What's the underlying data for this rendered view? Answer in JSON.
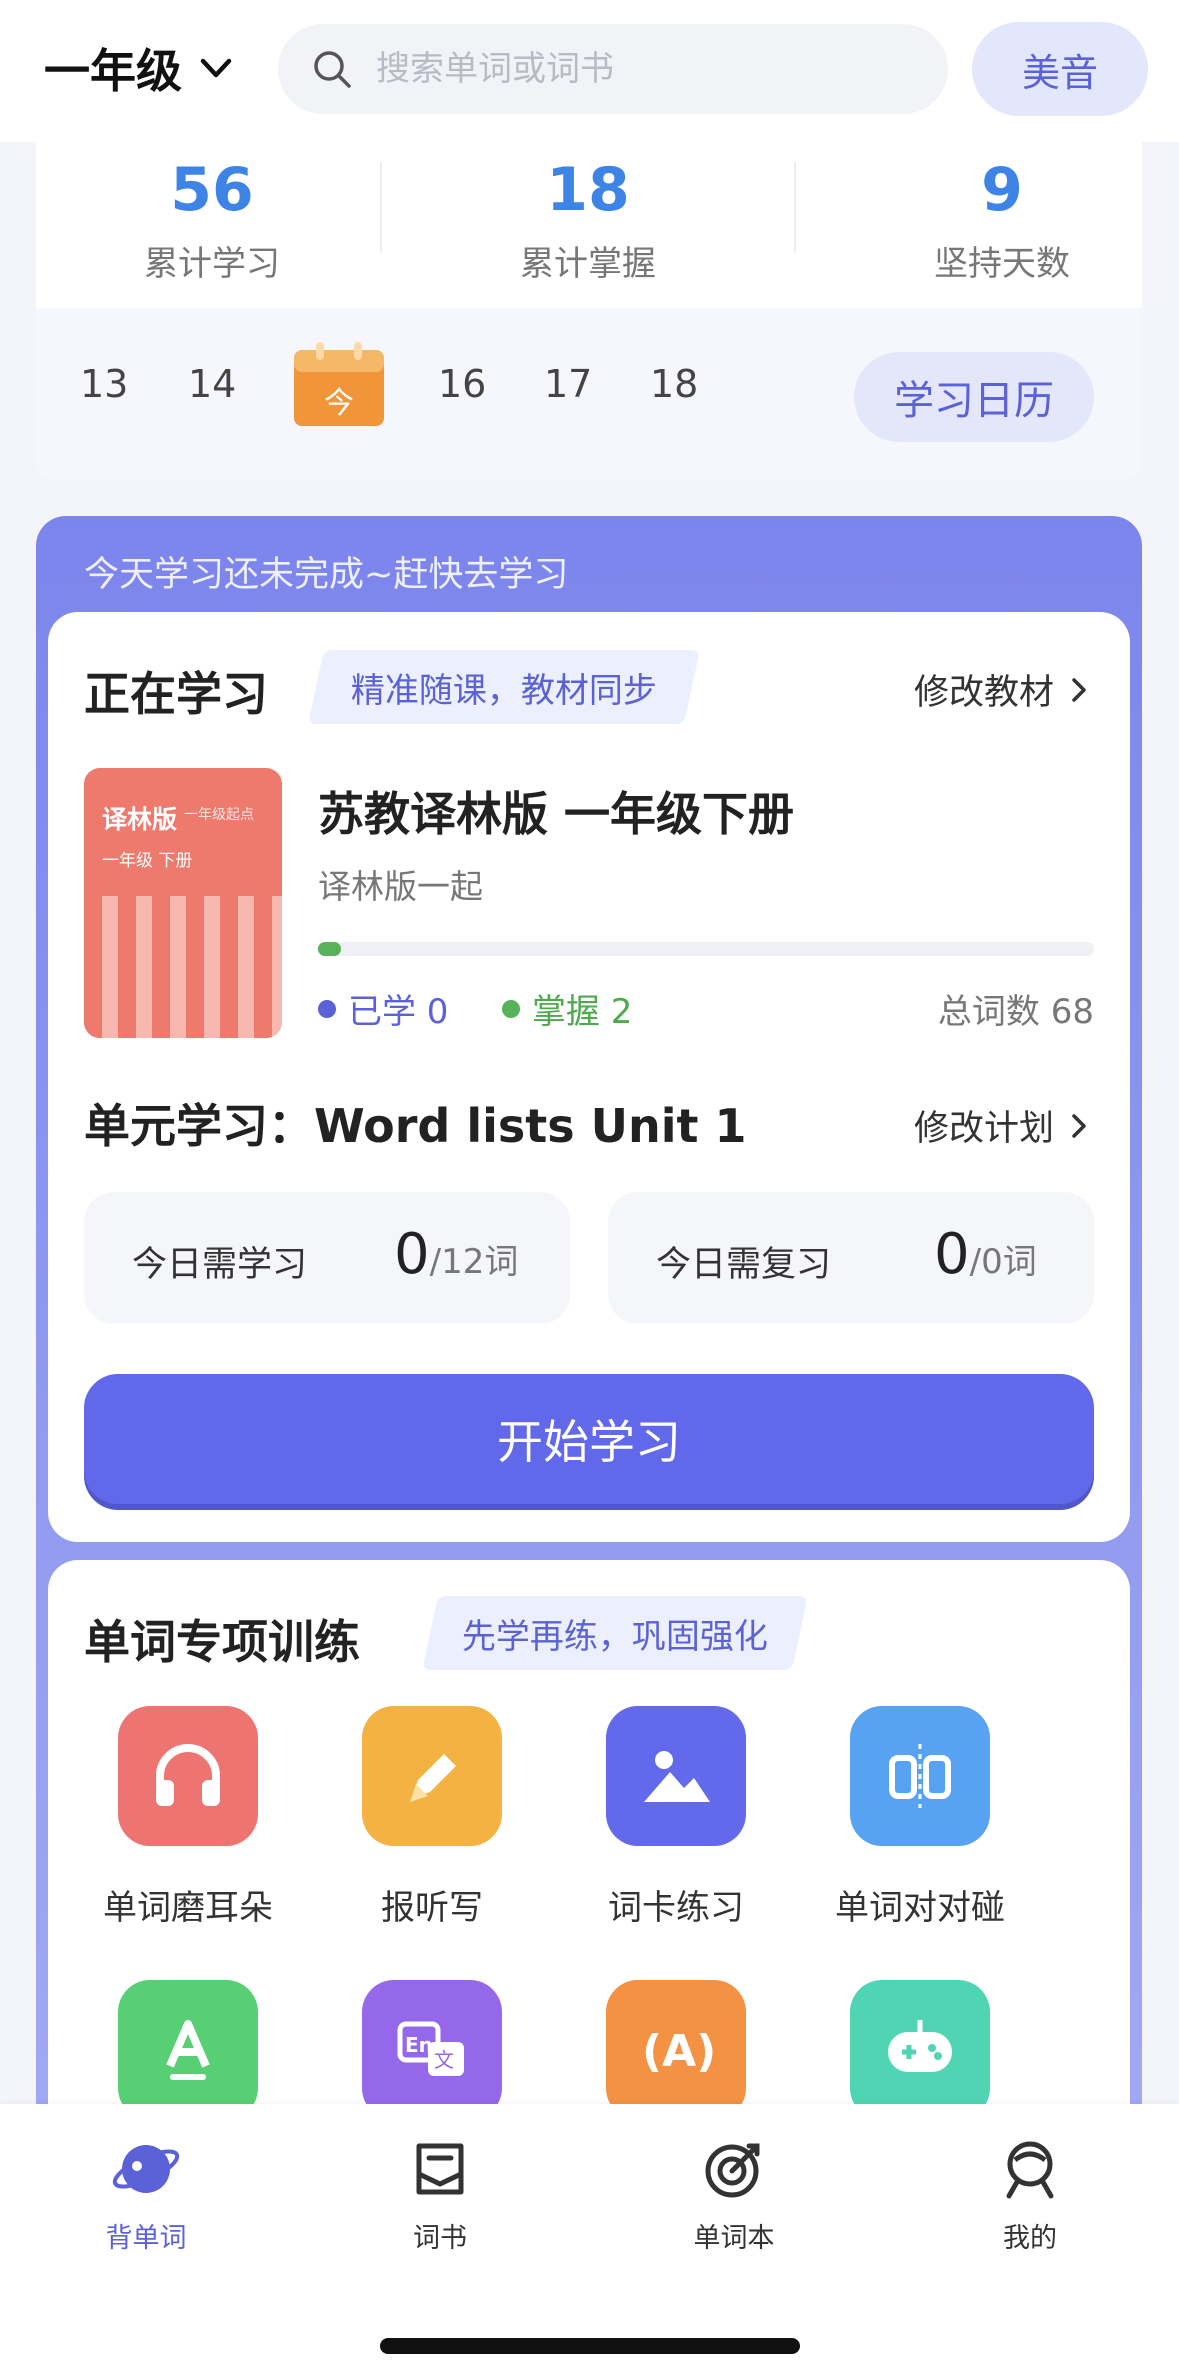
{
  "header": {
    "grade": "一年级",
    "search_placeholder": "搜索单词或词书",
    "accent_button": "美音"
  },
  "stats": [
    {
      "value": "56",
      "label": "累计学习"
    },
    {
      "value": "18",
      "label": "累计掌握"
    },
    {
      "value": "9",
      "label": "坚持天数"
    }
  ],
  "calendar": {
    "days": [
      "13",
      "14",
      "16",
      "17",
      "18"
    ],
    "today_label": "今",
    "button": "学习日历"
  },
  "notice": "今天学习还未完成~赶快去学习",
  "learning": {
    "title": "正在学习",
    "tag": "精准随课，教材同步",
    "change_link": "修改教材",
    "book_cover": {
      "title": "译林版",
      "note": "一年级起点",
      "subtitle": "一年级  下册"
    },
    "book_title": "苏教译林版 一年级下册",
    "book_sub": "译林版一起",
    "progress": 0.03,
    "learned_label": "已学 0",
    "mastered_label": "掌握 2",
    "total_label": "总词数 68",
    "unit_label": "单元学习：Word lists Unit 1",
    "plan_link": "修改计划",
    "today_learn_label": "今日需学习",
    "today_learn_value": "0",
    "today_learn_unit": "/12词",
    "today_review_label": "今日需复习",
    "today_review_value": "0",
    "today_review_unit": "/0词",
    "start_button": "开始学习"
  },
  "training": {
    "title": "单词专项训练",
    "tag": "先学再练，巩固强化",
    "items": [
      {
        "label": "单词磨耳朵",
        "icon": "headphones-icon",
        "color": "#ee7472"
      },
      {
        "label": "报听写",
        "icon": "pencil-icon",
        "color": "#f3b241"
      },
      {
        "label": "词卡练习",
        "icon": "image-icon",
        "color": "#6269ea"
      },
      {
        "label": "单词对对碰",
        "icon": "match-icon",
        "color": "#57a3f2"
      }
    ],
    "row2": [
      {
        "icon": "letter-a-icon",
        "color": "#58cf74"
      },
      {
        "icon": "translate-icon",
        "color": "#9568ea"
      },
      {
        "icon": "phonics-icon",
        "color": "#f39242"
      },
      {
        "icon": "game-icon",
        "color": "#4fd5b3"
      }
    ]
  },
  "nav": [
    {
      "label": "背单词",
      "icon": "planet-icon",
      "active": true
    },
    {
      "label": "词书",
      "icon": "book-icon",
      "active": false
    },
    {
      "label": "单词本",
      "icon": "target-icon",
      "active": false
    },
    {
      "label": "我的",
      "icon": "profile-icon",
      "active": false
    }
  ]
}
